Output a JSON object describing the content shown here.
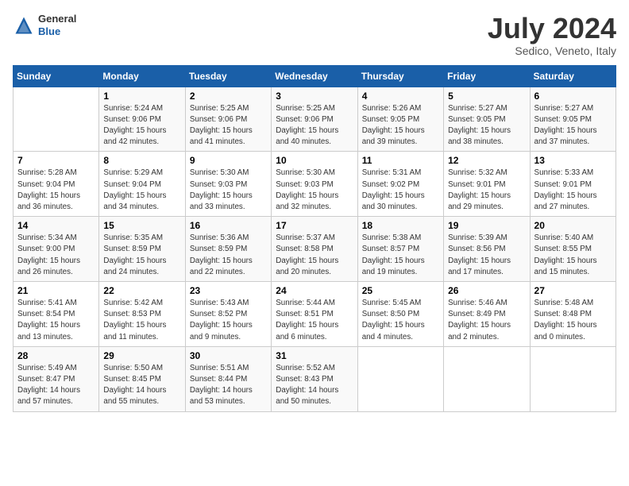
{
  "header": {
    "logo_general": "General",
    "logo_blue": "Blue",
    "month_title": "July 2024",
    "location": "Sedico, Veneto, Italy"
  },
  "weekdays": [
    "Sunday",
    "Monday",
    "Tuesday",
    "Wednesday",
    "Thursday",
    "Friday",
    "Saturday"
  ],
  "weeks": [
    [
      {
        "day": "",
        "info": ""
      },
      {
        "day": "1",
        "info": "Sunrise: 5:24 AM\nSunset: 9:06 PM\nDaylight: 15 hours\nand 42 minutes."
      },
      {
        "day": "2",
        "info": "Sunrise: 5:25 AM\nSunset: 9:06 PM\nDaylight: 15 hours\nand 41 minutes."
      },
      {
        "day": "3",
        "info": "Sunrise: 5:25 AM\nSunset: 9:06 PM\nDaylight: 15 hours\nand 40 minutes."
      },
      {
        "day": "4",
        "info": "Sunrise: 5:26 AM\nSunset: 9:05 PM\nDaylight: 15 hours\nand 39 minutes."
      },
      {
        "day": "5",
        "info": "Sunrise: 5:27 AM\nSunset: 9:05 PM\nDaylight: 15 hours\nand 38 minutes."
      },
      {
        "day": "6",
        "info": "Sunrise: 5:27 AM\nSunset: 9:05 PM\nDaylight: 15 hours\nand 37 minutes."
      }
    ],
    [
      {
        "day": "7",
        "info": "Sunrise: 5:28 AM\nSunset: 9:04 PM\nDaylight: 15 hours\nand 36 minutes."
      },
      {
        "day": "8",
        "info": "Sunrise: 5:29 AM\nSunset: 9:04 PM\nDaylight: 15 hours\nand 34 minutes."
      },
      {
        "day": "9",
        "info": "Sunrise: 5:30 AM\nSunset: 9:03 PM\nDaylight: 15 hours\nand 33 minutes."
      },
      {
        "day": "10",
        "info": "Sunrise: 5:30 AM\nSunset: 9:03 PM\nDaylight: 15 hours\nand 32 minutes."
      },
      {
        "day": "11",
        "info": "Sunrise: 5:31 AM\nSunset: 9:02 PM\nDaylight: 15 hours\nand 30 minutes."
      },
      {
        "day": "12",
        "info": "Sunrise: 5:32 AM\nSunset: 9:01 PM\nDaylight: 15 hours\nand 29 minutes."
      },
      {
        "day": "13",
        "info": "Sunrise: 5:33 AM\nSunset: 9:01 PM\nDaylight: 15 hours\nand 27 minutes."
      }
    ],
    [
      {
        "day": "14",
        "info": "Sunrise: 5:34 AM\nSunset: 9:00 PM\nDaylight: 15 hours\nand 26 minutes."
      },
      {
        "day": "15",
        "info": "Sunrise: 5:35 AM\nSunset: 8:59 PM\nDaylight: 15 hours\nand 24 minutes."
      },
      {
        "day": "16",
        "info": "Sunrise: 5:36 AM\nSunset: 8:59 PM\nDaylight: 15 hours\nand 22 minutes."
      },
      {
        "day": "17",
        "info": "Sunrise: 5:37 AM\nSunset: 8:58 PM\nDaylight: 15 hours\nand 20 minutes."
      },
      {
        "day": "18",
        "info": "Sunrise: 5:38 AM\nSunset: 8:57 PM\nDaylight: 15 hours\nand 19 minutes."
      },
      {
        "day": "19",
        "info": "Sunrise: 5:39 AM\nSunset: 8:56 PM\nDaylight: 15 hours\nand 17 minutes."
      },
      {
        "day": "20",
        "info": "Sunrise: 5:40 AM\nSunset: 8:55 PM\nDaylight: 15 hours\nand 15 minutes."
      }
    ],
    [
      {
        "day": "21",
        "info": "Sunrise: 5:41 AM\nSunset: 8:54 PM\nDaylight: 15 hours\nand 13 minutes."
      },
      {
        "day": "22",
        "info": "Sunrise: 5:42 AM\nSunset: 8:53 PM\nDaylight: 15 hours\nand 11 minutes."
      },
      {
        "day": "23",
        "info": "Sunrise: 5:43 AM\nSunset: 8:52 PM\nDaylight: 15 hours\nand 9 minutes."
      },
      {
        "day": "24",
        "info": "Sunrise: 5:44 AM\nSunset: 8:51 PM\nDaylight: 15 hours\nand 6 minutes."
      },
      {
        "day": "25",
        "info": "Sunrise: 5:45 AM\nSunset: 8:50 PM\nDaylight: 15 hours\nand 4 minutes."
      },
      {
        "day": "26",
        "info": "Sunrise: 5:46 AM\nSunset: 8:49 PM\nDaylight: 15 hours\nand 2 minutes."
      },
      {
        "day": "27",
        "info": "Sunrise: 5:48 AM\nSunset: 8:48 PM\nDaylight: 15 hours\nand 0 minutes."
      }
    ],
    [
      {
        "day": "28",
        "info": "Sunrise: 5:49 AM\nSunset: 8:47 PM\nDaylight: 14 hours\nand 57 minutes."
      },
      {
        "day": "29",
        "info": "Sunrise: 5:50 AM\nSunset: 8:45 PM\nDaylight: 14 hours\nand 55 minutes."
      },
      {
        "day": "30",
        "info": "Sunrise: 5:51 AM\nSunset: 8:44 PM\nDaylight: 14 hours\nand 53 minutes."
      },
      {
        "day": "31",
        "info": "Sunrise: 5:52 AM\nSunset: 8:43 PM\nDaylight: 14 hours\nand 50 minutes."
      },
      {
        "day": "",
        "info": ""
      },
      {
        "day": "",
        "info": ""
      },
      {
        "day": "",
        "info": ""
      }
    ]
  ]
}
